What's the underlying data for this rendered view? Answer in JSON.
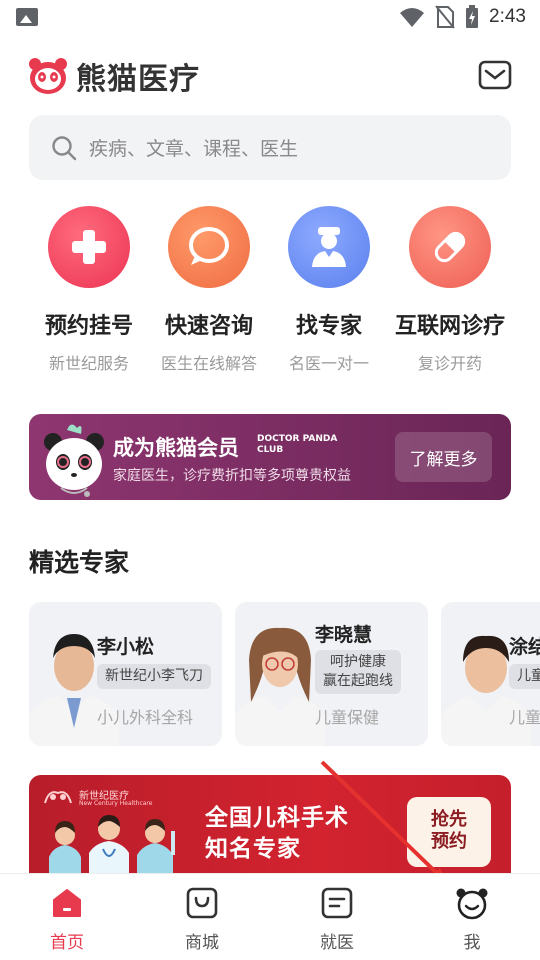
{
  "status_bar": {
    "time": "2:43"
  },
  "header": {
    "app_name": "熊猫医疗"
  },
  "search": {
    "placeholder": "疾病、文章、课程、医生"
  },
  "services": [
    {
      "title": "预约挂号",
      "subtitle": "新世纪服务",
      "icon": "plus-icon",
      "color": "#ef3f5b"
    },
    {
      "title": "快速咨询",
      "subtitle": "医生在线解答",
      "icon": "chat-bubble-icon",
      "color": "#f2754a"
    },
    {
      "title": "找专家",
      "subtitle": "名医一对一",
      "icon": "doctor-icon",
      "color": "#5f86f0"
    },
    {
      "title": "互联网诊疗",
      "subtitle": "复诊开药",
      "icon": "pill-icon",
      "color": "#f06a5e"
    }
  ],
  "member_banner": {
    "title": "成为熊猫会员",
    "club_line1": "DOCTOR PANDA",
    "club_line2": "CLUB",
    "subtitle": "家庭医生，诊疗费折扣等多项尊贵权益",
    "button": "了解更多"
  },
  "experts_section": {
    "title": "精选专家"
  },
  "experts": [
    {
      "name": "李小松",
      "tag": "新世纪小李飞刀",
      "department": "小儿外科全科"
    },
    {
      "name": "李晓慧",
      "tag_line1": "呵护健康",
      "tag_line2": "赢在起跑线",
      "department": "儿童保健"
    },
    {
      "name": "涂结",
      "tag": "儿童",
      "department": "儿童"
    }
  ],
  "promo_banner": {
    "brand": "新世纪医疗",
    "brand_sub": "New Century Healthcare",
    "title_line1": "全国儿科手术",
    "title_line2": "知名专家",
    "button_line1": "抢先",
    "button_line2": "预约"
  },
  "bottom_nav": [
    {
      "label": "首页",
      "icon": "home-icon",
      "active": true
    },
    {
      "label": "商城",
      "icon": "shop-bag-icon",
      "active": false
    },
    {
      "label": "就医",
      "icon": "medical-record-icon",
      "active": false
    },
    {
      "label": "我",
      "icon": "panda-face-icon",
      "active": false
    }
  ],
  "colors": {
    "accent": "#e83a4e",
    "member_bg": "#7a2d63",
    "promo_bg": "#c81f2c"
  }
}
